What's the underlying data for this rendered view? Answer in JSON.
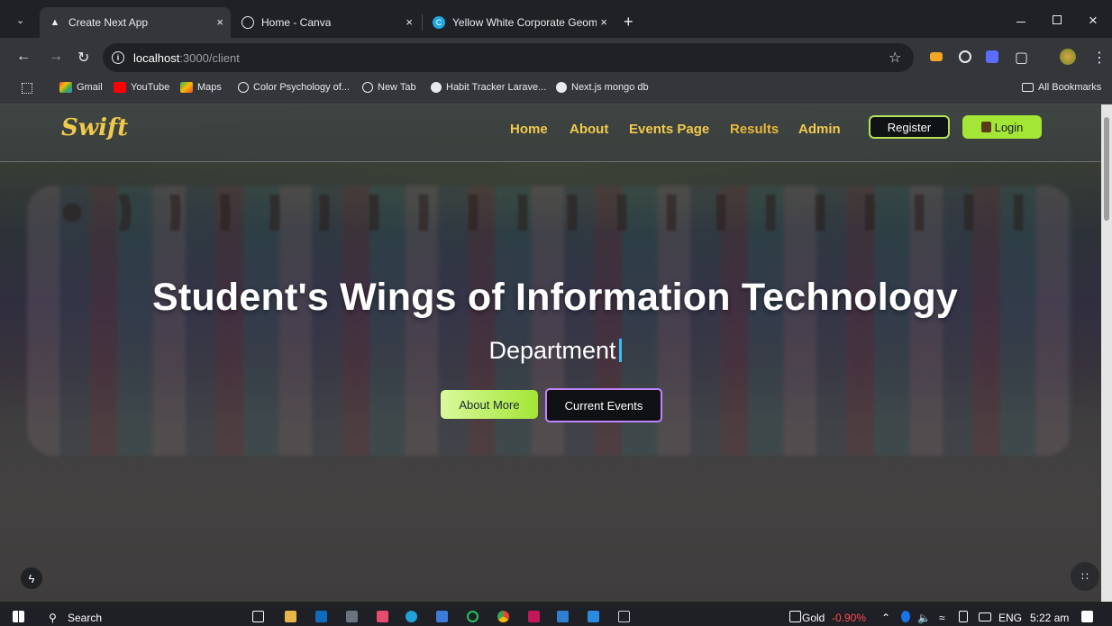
{
  "browser": {
    "tabs": [
      {
        "title": "Create Next App",
        "active": true
      },
      {
        "title": "Home - Canva",
        "active": false
      },
      {
        "title": "Yellow White Corporate Geome",
        "active": false
      }
    ],
    "new_tab": "+",
    "close_glyph": "×",
    "url": {
      "host": "localhost",
      "rest": ":3000/client"
    },
    "bookmarks": [
      "Gmail",
      "YouTube",
      "Maps",
      "Color Psychology of...",
      "New Tab",
      "Habit Tracker Larave...",
      "Next.js mongo db"
    ],
    "all_bookmarks": "All Bookmarks"
  },
  "site": {
    "brand": "Swift",
    "nav": [
      "Home",
      "About",
      "Events Page",
      "Results",
      "Admin"
    ],
    "register": "Register",
    "login": "Login"
  },
  "hero": {
    "title": "Student's Wings of Information Technology",
    "subtitle": "Department",
    "about_button": "About More",
    "events_button": "Current Events"
  },
  "taskbar": {
    "search": "Search",
    "gold_label": "Gold",
    "gold_change": "-0.90%",
    "lang": "ENG",
    "time": "5:22 am"
  },
  "colors": {
    "accent_yellow": "#f2c94c",
    "accent_green": "#a3e635",
    "accent_purple": "#c084fc",
    "negative": "#ff4d4d"
  }
}
